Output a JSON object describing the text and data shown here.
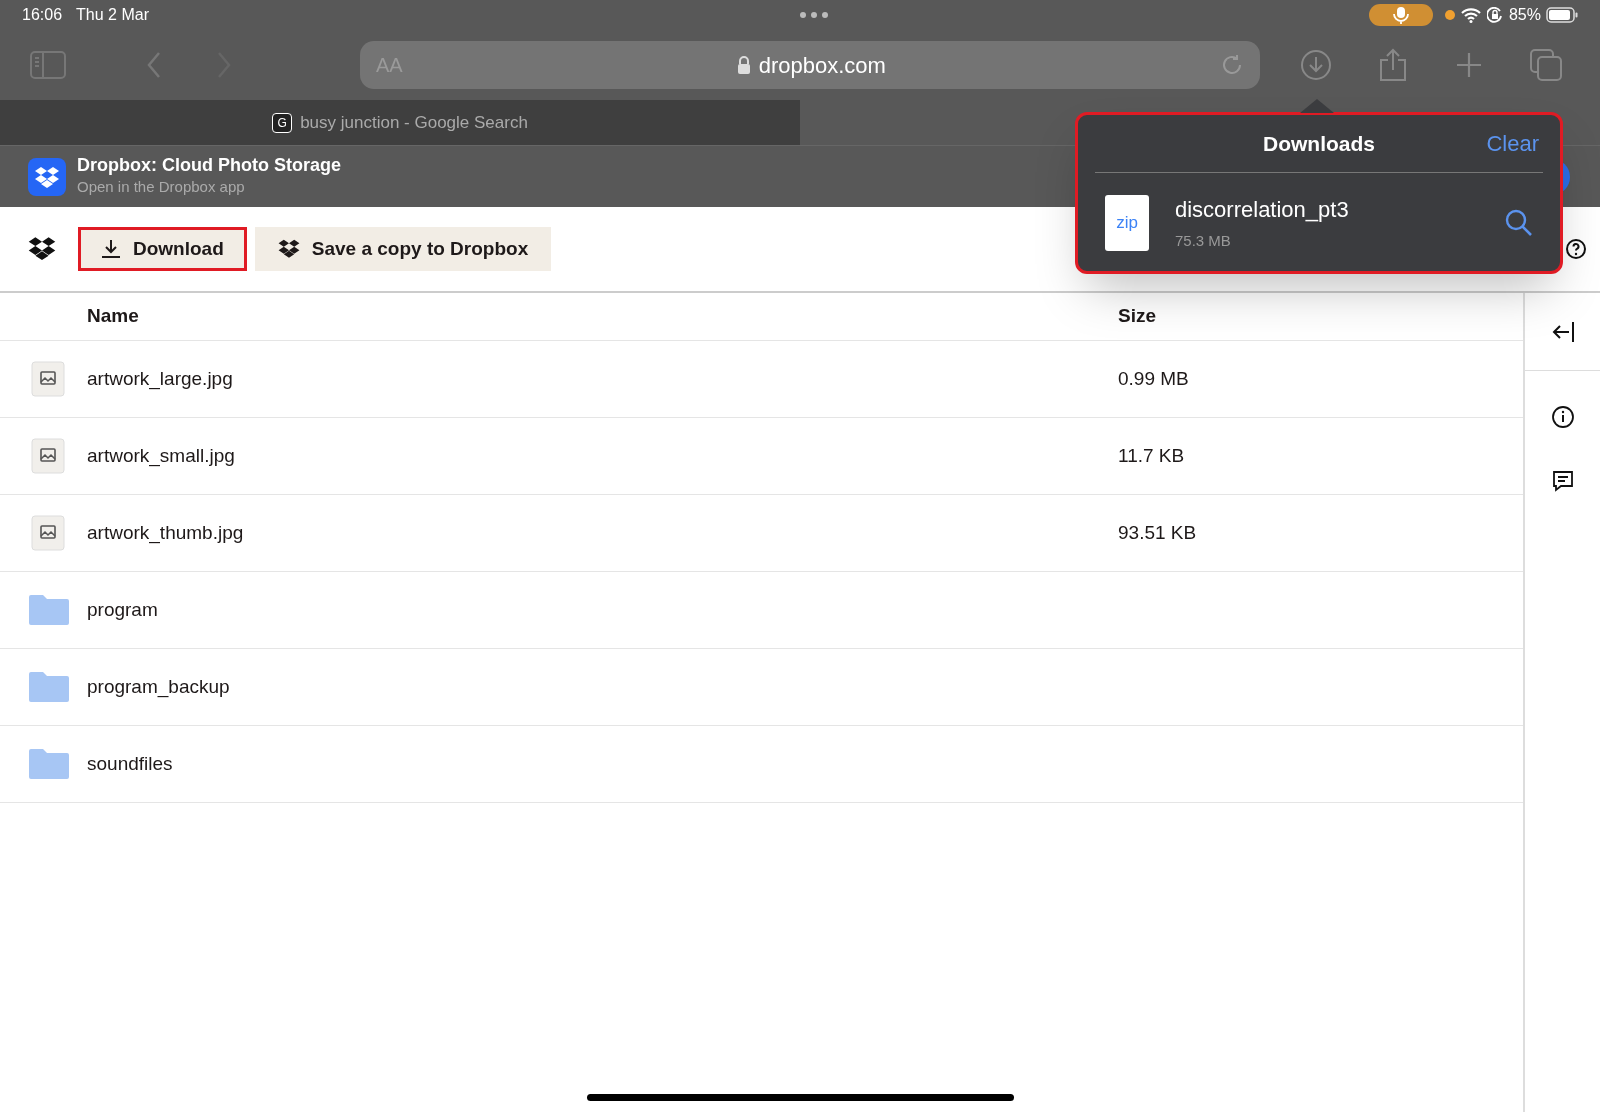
{
  "status_bar": {
    "time": "16:06",
    "date": "Thu 2 Mar",
    "battery": "85%"
  },
  "address_bar": {
    "text_size": "AA",
    "url": "dropbox.com"
  },
  "tabs": [
    {
      "title": "busy junction - Google Search",
      "favicon": "G",
      "selected": false
    },
    {
      "selected": true
    }
  ],
  "app_banner": {
    "title": "Dropbox: Cloud Photo Storage",
    "subtitle": "Open in the Dropbox app"
  },
  "toolbar": {
    "buttons": [
      {
        "label": "Download",
        "kind": "download",
        "highlighted": true
      },
      {
        "label": "Save a copy to Dropbox",
        "kind": "dropbox",
        "highlighted": false
      }
    ]
  },
  "table": {
    "columns": [
      "Name",
      "Size"
    ],
    "rows": [
      {
        "kind": "image",
        "name": "artwork_large.jpg",
        "size": "0.99 MB"
      },
      {
        "kind": "image",
        "name": "artwork_small.jpg",
        "size": "11.7 KB"
      },
      {
        "kind": "image",
        "name": "artwork_thumb.jpg",
        "size": "93.51 KB"
      },
      {
        "kind": "folder",
        "name": "program"
      },
      {
        "kind": "folder",
        "name": "program_backup"
      },
      {
        "kind": "folder",
        "name": "soundfiles"
      }
    ]
  },
  "downloads_popover": {
    "title": "Downloads",
    "clear": "Clear",
    "highlighted": true,
    "items": [
      {
        "name": "discorrelation_pt3",
        "size": "75.3 MB",
        "type": "zip"
      }
    ]
  }
}
